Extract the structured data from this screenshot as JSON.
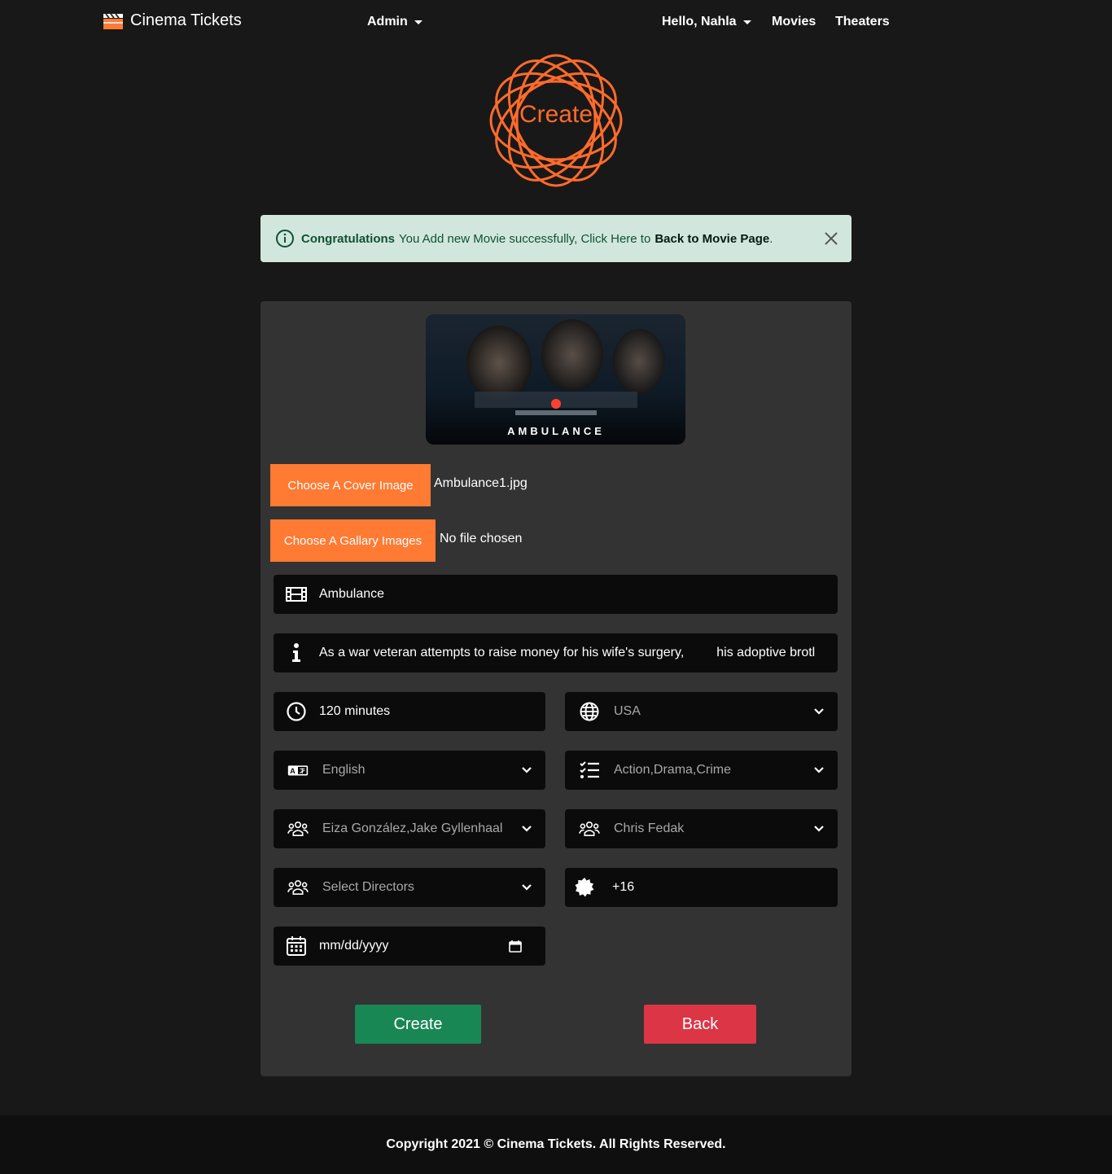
{
  "navbar": {
    "brand": "Cinema Tickets",
    "admin_label": "Admin",
    "greeting": "Hello, Nahla",
    "movies_label": "Movies",
    "theaters_label": "Theaters"
  },
  "badge": {
    "text": "Create"
  },
  "alert": {
    "strong": "Congratulations",
    "message": "You Add new Movie successfully, Click Here to",
    "link": "Back to Movie Page",
    "period": "."
  },
  "form": {
    "poster_title": "AMBULANCE",
    "cover_button": "Choose A Cover Image",
    "cover_file": "Ambulance1.jpg",
    "gallery_button": "Choose A Gallary Images",
    "gallery_file": "No file chosen",
    "name": "Ambulance",
    "description": "As a war veteran attempts to raise money for his wife's surgery,         his adoptive brotl",
    "duration": "120 minutes",
    "country": "USA",
    "language": "English",
    "genres": "Action,Drama,Crime",
    "actors": "Eiza González,Jake Gyllenhaal",
    "producers": "Chris Fedak",
    "directors_placeholder": "Select Directors",
    "age_rating": "+16",
    "date_placeholder": "mm/dd/yyyy",
    "create_button": "Create",
    "back_button": "Back"
  },
  "colors": {
    "accent": "#ff7a33",
    "create_green": "#198754",
    "back_red": "#dc3545",
    "alert_bg": "#d1e7dd"
  },
  "footer": {
    "text": "Copyright 2021 © Cinema Tickets. All Rights Reserved."
  }
}
